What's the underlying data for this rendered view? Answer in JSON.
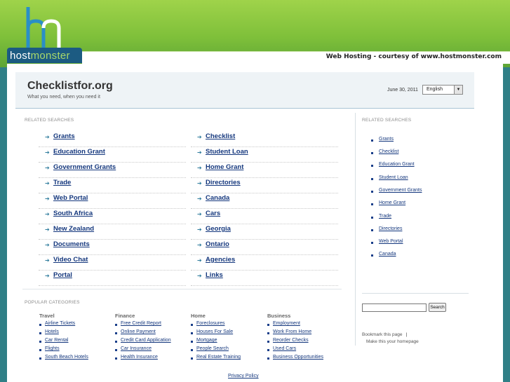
{
  "host": {
    "logo_host": "host",
    "logo_monster": "monster",
    "hosting_text": "Web Hosting - courtesy of www.hostmonster.com"
  },
  "site": {
    "title": "Checklistfor.org",
    "tagline": "What you need, when you need it",
    "date": "June 30, 2011",
    "language": "English"
  },
  "main": {
    "related_label": "RELATED SEARCHES",
    "left_links": [
      "Grants",
      "Education Grant",
      "Government Grants",
      "Trade",
      "Web Portal",
      "South Africa",
      "New Zealand",
      "Documents",
      "Video Chat",
      "Portal"
    ],
    "right_links": [
      "Checklist",
      "Student Loan",
      "Home Grant",
      "Directories",
      "Canada",
      "Cars",
      "Georgia",
      "Ontario",
      "Agencies",
      "Links"
    ]
  },
  "sidebar": {
    "related_label": "RELATED SEARCHES",
    "links": [
      "Grants",
      "Checklist",
      "Education Grant",
      "Student Loan",
      "Government Grants",
      "Home Grant",
      "Trade",
      "Directories",
      "Web Portal",
      "Canada"
    ],
    "search_button": "Search",
    "bookmark": "Bookmark this page",
    "homepage": "Make this your homepage"
  },
  "popular": {
    "label": "POPULAR CATEGORIES",
    "columns": [
      {
        "title": "Travel",
        "items": [
          "Airline Tickets",
          "Hotels",
          "Car Rental",
          "Flights",
          "South Beach Hotels"
        ]
      },
      {
        "title": "Finance",
        "items": [
          "Free Credit Report",
          "Online Payment",
          "Credit Card Application",
          "Car Insurance",
          "Health Insurance"
        ]
      },
      {
        "title": "Home",
        "items": [
          "Foreclosures",
          "Houses For Sale",
          "Mortgage",
          "People Search",
          "Real Estate Training"
        ]
      },
      {
        "title": "Business",
        "items": [
          "Employment",
          "Work From Home",
          "Reorder Checks",
          "Used Cars",
          "Business Opportunities"
        ]
      }
    ]
  },
  "footer": {
    "privacy": "Privacy Policy"
  },
  "colors": {
    "link": "#14377d",
    "header_green": "#7fc03a",
    "host_blue": "#1c5b82"
  }
}
